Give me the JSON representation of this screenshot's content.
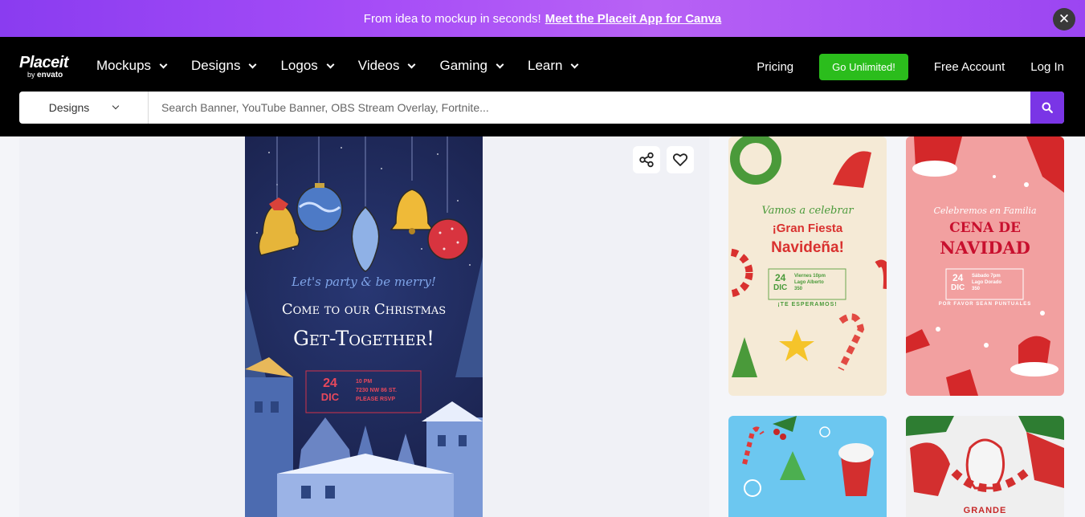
{
  "promo": {
    "text": "From idea to mockup in seconds!",
    "link": "Meet the Placeit App for Canva",
    "close": "✕"
  },
  "logo": {
    "main": "Placeit",
    "by": "by",
    "brand": "envato"
  },
  "nav": {
    "menu": [
      "Mockups",
      "Designs",
      "Logos",
      "Videos",
      "Gaming",
      "Learn"
    ],
    "pricing": "Pricing",
    "cta": "Go Unlimited!",
    "free_account": "Free Account",
    "login": "Log In"
  },
  "search": {
    "category": "Designs",
    "placeholder": "Search Banner, YouTube Banner, OBS Stream Overlay, Fortnite..."
  },
  "poster": {
    "script": "Let's party & be merry!",
    "line1": "Come to our Christmas",
    "line2": "Get-Together!",
    "day": "24",
    "month": "DIC",
    "time": "10 PM",
    "address": "7230 NW 86 ST.",
    "rsvp": "PLEASE RSVP"
  },
  "thumbs": [
    {
      "script": "Vamos a celebrar",
      "title1": "¡Gran Fiesta",
      "title2": "Navideña!",
      "day": "24",
      "month": "DIC",
      "info1": "Viernes 10pm",
      "info2": "Lago Alberto",
      "info3": "350",
      "footer": "¡TE ESPERAMOS!"
    },
    {
      "script": "Celebremos en Familia",
      "title1": "CENA DE",
      "title2": "NAVIDAD",
      "day": "24",
      "month": "DIC",
      "info1": "Sábado 7pm",
      "info2": "Lago Dorado",
      "info3": "350",
      "footer": "POR FAVOR SEAN PUNTUALES"
    },
    {
      "label": ""
    },
    {
      "label": "GRANDE"
    }
  ],
  "colors": {
    "accent": "#7a35e6",
    "cta": "#2bbd1c",
    "nav_bg": "#000000"
  }
}
